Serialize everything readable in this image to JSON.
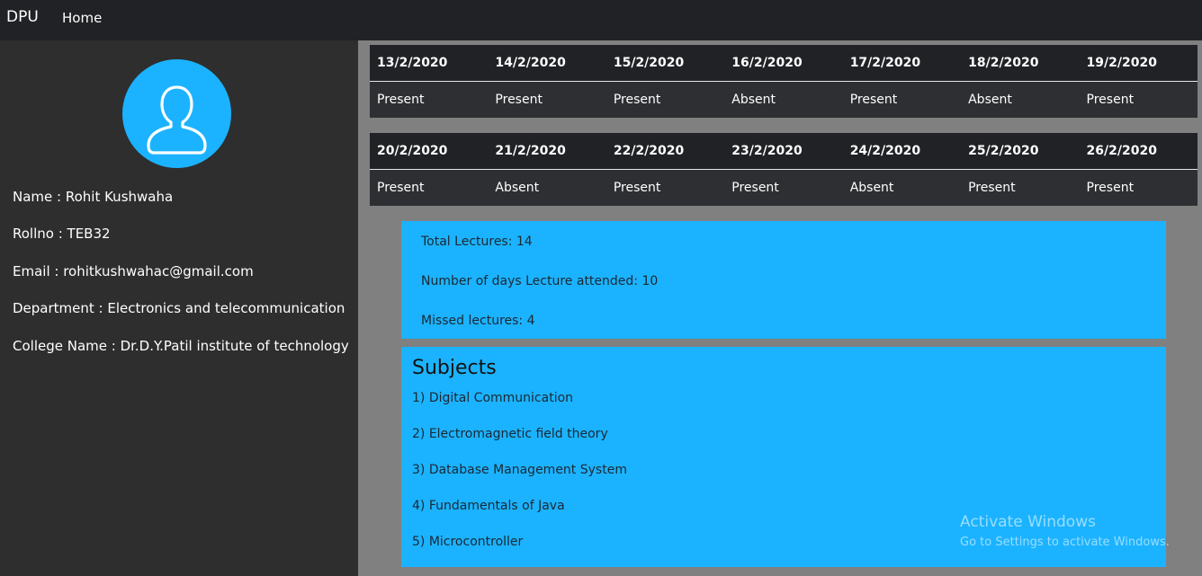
{
  "nav": {
    "brand": "DPU",
    "home": "Home"
  },
  "profile": {
    "avatar_icon": "user-icon",
    "name": "Name : Rohit Kushwaha",
    "rollno": "Rollno : TEB32",
    "email": "Email : rohitkushwahac@gmail.com",
    "department": "Department : Electronics and telecommunication",
    "college": "College Name : Dr.D.Y.Patil institute of technology"
  },
  "attendance": {
    "week1": {
      "dates": [
        "13/2/2020",
        "14/2/2020",
        "15/2/2020",
        "16/2/2020",
        "17/2/2020",
        "18/2/2020",
        "19/2/2020"
      ],
      "status": [
        "Present",
        "Present",
        "Present",
        "Absent",
        "Present",
        "Absent",
        "Present"
      ]
    },
    "week2": {
      "dates": [
        "20/2/2020",
        "21/2/2020",
        "22/2/2020",
        "23/2/2020",
        "24/2/2020",
        "25/2/2020",
        "26/2/2020"
      ],
      "status": [
        "Present",
        "Absent",
        "Present",
        "Present",
        "Absent",
        "Present",
        "Present"
      ]
    }
  },
  "summary": {
    "total": "Total Lectures: 14",
    "attended": "Number of days Lecture attended: 10",
    "missed": "Missed lectures: 4"
  },
  "subjects": {
    "heading": "Subjects",
    "items": [
      "1) Digital Communication",
      "2) Electromagnetic field theory",
      "3) Database Management System",
      "4) Fundamentals of Java",
      "5) Microcontroller"
    ]
  },
  "watermark": {
    "line1": "Activate Windows",
    "line2": "Go to Settings to activate Windows."
  },
  "colors": {
    "navbar": "#212226",
    "sidebar": "#2e2e2e",
    "accent": "#1bb3ff",
    "background": "#808080"
  }
}
